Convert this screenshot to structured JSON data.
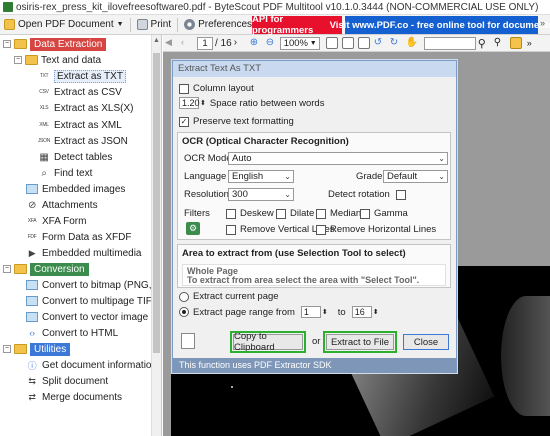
{
  "window": {
    "title": "osiris-rex_press_kit_ilovefreesoftware0.pdf - ByteScout PDF Multitool v10.1.0.3444 (NON-COMMERCIAL USE ONLY)"
  },
  "toolbar": {
    "open_label": "Open PDF Document",
    "print_label": "Print",
    "preferences_label": "Preferences",
    "api_banner": "API for programmers",
    "web_banner": "Visit www.PDF.co - free online tool for documents"
  },
  "nav": {
    "page_value": "1",
    "page_total": "/ 16",
    "zoom_value": "100%"
  },
  "sidebar": {
    "categories": [
      {
        "label": "Data Extraction",
        "subgroups": [
          {
            "label": "Text and data",
            "items": [
              {
                "icon_text": "TXT",
                "label": "Extract as TXT"
              },
              {
                "icon_text": "CSV",
                "label": "Extract as CSV"
              },
              {
                "icon_text": "XLS",
                "label": "Extract as XLS(X)"
              },
              {
                "icon_text": "XML",
                "label": "Extract as XML"
              },
              {
                "icon_text": "JSON",
                "label": "Extract as JSON"
              },
              {
                "icon_text": "▦",
                "label": "Detect tables"
              },
              {
                "icon_text": "⌕",
                "label": "Find text"
              }
            ]
          }
        ],
        "items": [
          {
            "label": "Embedded images"
          },
          {
            "label": "Attachments"
          },
          {
            "label": "XFA Form"
          },
          {
            "label": "Form Data as XFDF"
          },
          {
            "label": "Embedded multimedia"
          }
        ]
      },
      {
        "label": "Conversion",
        "items": [
          {
            "label": "Convert to bitmap (PNG, JPEG"
          },
          {
            "label": "Convert to multipage TIFF"
          },
          {
            "label": "Convert to vector image (EMF"
          },
          {
            "label": "Convert to HTML"
          }
        ]
      },
      {
        "label": "Utilities",
        "items": [
          {
            "label": "Get document information"
          },
          {
            "label": "Split document"
          },
          {
            "label": "Merge documents"
          }
        ]
      }
    ]
  },
  "dialog": {
    "title": "Extract Text As TXT",
    "column_layout": "Column layout",
    "space_ratio_value": "1.20",
    "space_ratio_label": "Space ratio between words",
    "preserve_formatting": "Preserve text formatting",
    "ocr": {
      "heading": "OCR (Optical Character Recognition)",
      "mode_label": "OCR Mode",
      "mode_value": "Auto",
      "language_label": "Language",
      "language_value": "English",
      "grade_label": "Grade",
      "grade_value": "Default",
      "resolution_label": "Resolution",
      "resolution_value": "300",
      "detect_rotation": "Detect rotation",
      "filters_label": "Filters",
      "filters": [
        "Deskew",
        "Dilate",
        "Median",
        "Gamma"
      ],
      "remove_vertical": "Remove Vertical Lines",
      "remove_horizontal": "Remove Horizontal Lines"
    },
    "area": {
      "heading": "Area to extract from (use Selection Tool to select)",
      "whole_page": "Whole Page",
      "hint": "To extract from area select the area with \"Select Tool\"."
    },
    "extract_current": "Extract current page",
    "extract_range": "Extract page range from",
    "range_from": "1",
    "range_to_label": "to",
    "range_to": "16",
    "copy_button": "Copy to Clipboard",
    "or_label": "or",
    "extract_button": "Extract to File",
    "close_button": "Close",
    "footer": "This function uses PDF Extractor SDK"
  }
}
